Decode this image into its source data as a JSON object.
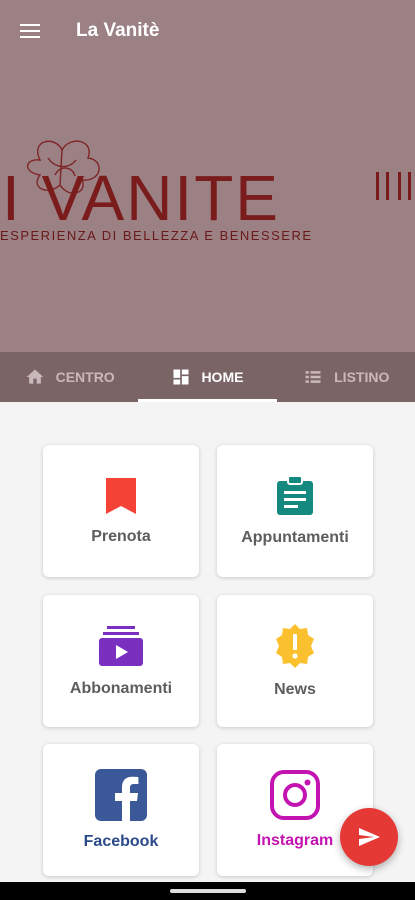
{
  "app": {
    "title": "La Vanitè"
  },
  "hero": {
    "logo_text": "I VANITE",
    "logo_tagline": "ESPERIENZA DI BELLEZZA E BENESSERE"
  },
  "tabs": [
    {
      "label": "CENTRO",
      "icon": "home-icon",
      "active": false
    },
    {
      "label": "HOME",
      "icon": "dashboard-icon",
      "active": true
    },
    {
      "label": "LISTINO",
      "icon": "list-icon",
      "active": false
    }
  ],
  "tiles": [
    {
      "label": "Prenota",
      "icon": "bookmark-icon",
      "color": "#f44336"
    },
    {
      "label": "Appuntamenti",
      "icon": "clipboard-icon",
      "color": "#14897f"
    },
    {
      "label": "Abbonamenti",
      "icon": "subscriptions-icon",
      "color": "#7b2fbf"
    },
    {
      "label": "News",
      "icon": "alert-badge-icon",
      "color": "#fbc02d"
    },
    {
      "label": "Facebook",
      "icon": "facebook-icon",
      "color": "#3b5998"
    },
    {
      "label": "Instagram",
      "icon": "instagram-icon",
      "color": "#c313b0"
    }
  ],
  "colors": {
    "hero_bg": "#9b8084",
    "tab_bar": "#7a6466",
    "fab": "#e53935",
    "logo": "#7b1c1c"
  },
  "fab": {
    "icon": "send-icon"
  }
}
